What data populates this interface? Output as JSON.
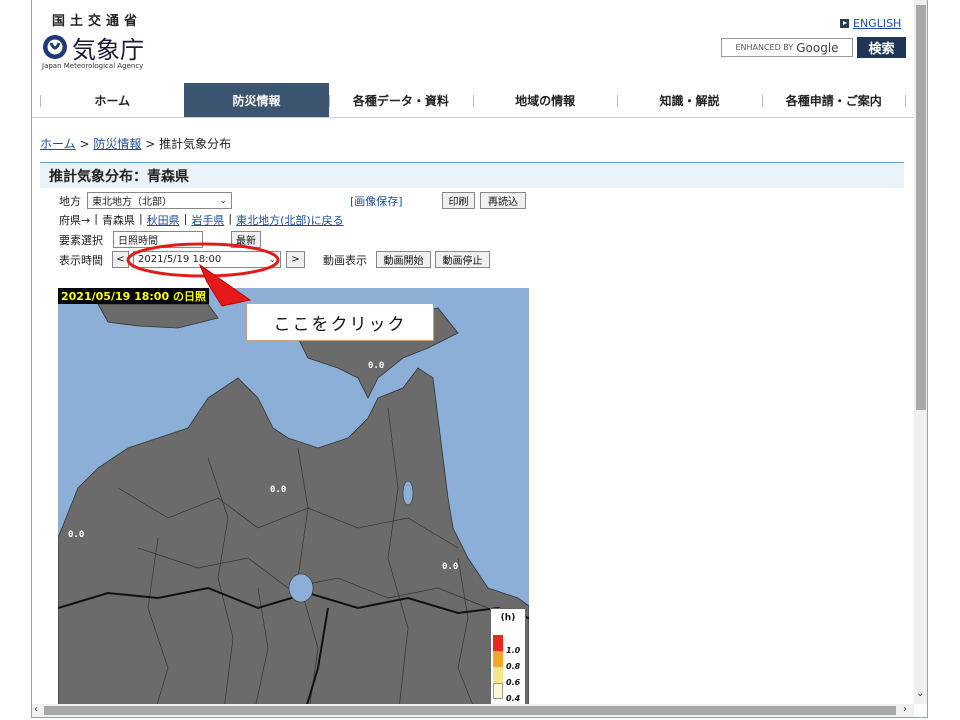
{
  "header": {
    "ministry": "国土交通省",
    "logo_text": "気象庁",
    "logo_sub": "Japan Meteorological Agency",
    "english": "ENGLISH",
    "search_enhanced": "ENHANCED BY",
    "search_google": "Google",
    "search_button": "検索"
  },
  "nav": {
    "items": [
      {
        "label": "ホーム"
      },
      {
        "label": "防災情報"
      },
      {
        "label": "各種データ・資料"
      },
      {
        "label": "地域の情報"
      },
      {
        "label": "知識・解説"
      },
      {
        "label": "各種申請・ご案内"
      }
    ],
    "active_index": 1
  },
  "breadcrumb": {
    "home": "ホーム",
    "sep": ">",
    "disaster": "防災情報",
    "current": "推計気象分布"
  },
  "page": {
    "title": "推計気象分布：青森県"
  },
  "controls": {
    "region_label": "地方",
    "region_value": "東北地方（北部）",
    "save_image": "[画像保存]",
    "print": "印刷",
    "reload": "再読込",
    "pref_label": "府県→",
    "pref_sep": "|",
    "pref_current": "青森県",
    "pref_akita": "秋田県",
    "pref_iwate": "岩手県",
    "pref_back": "東北地方(北部)に戻る",
    "element_label": "要素選択",
    "element_value": "日照時間",
    "latest": "最新",
    "time_label": "表示時間",
    "prev": "<",
    "time_value": "2021/5/19 18:00",
    "next": ">",
    "anim_label": "動画表示",
    "anim_start": "動画開始",
    "anim_stop": "動画停止"
  },
  "map": {
    "caption": "2021/05/19 18:00 の日照",
    "values": [
      "0.0",
      "0.0",
      "0.0",
      "0.0"
    ],
    "legend": {
      "unit": "(h)",
      "entries": [
        {
          "label": "1.0",
          "color": "#e8281e"
        },
        {
          "label": "0.8",
          "color": "#f5a623"
        },
        {
          "label": "0.6",
          "color": "#f7e58c"
        },
        {
          "label": "0.4",
          "color": "#fdf7d6"
        }
      ]
    }
  },
  "annotation": {
    "callout": "ここをクリック",
    "highlight_color": "#e61919"
  }
}
